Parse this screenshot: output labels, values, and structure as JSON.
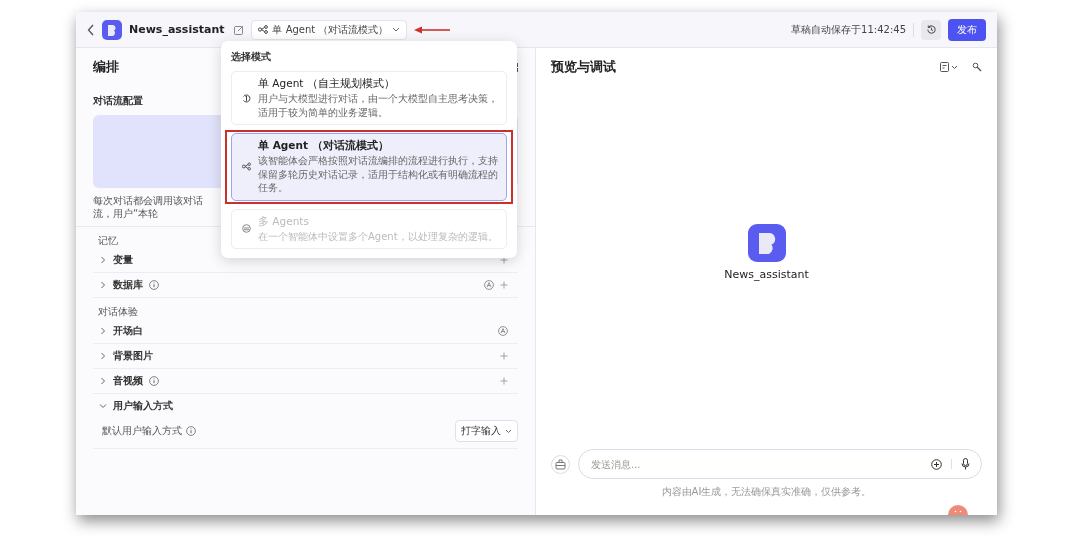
{
  "header": {
    "app_name": "News_assistant",
    "mode_button": "单 Agent （对话流模式）",
    "save_status": "草稿自动保存于11:42:45",
    "publish": "发布"
  },
  "mode_menu": {
    "title": "选择模式",
    "options": [
      {
        "title": "单 Agent （自主规划模式）",
        "description": "用户与大模型进行对话，由一个大模型自主思考决策，适用于较为简单的业务逻辑。",
        "selected": false,
        "disabled": false
      },
      {
        "title": "单 Agent （对话流模式）",
        "description": "该智能体会严格按照对话流编排的流程进行执行，支持保留多轮历史对话记录，适用于结构化或有明确流程的任务。",
        "selected": true,
        "disabled": false
      },
      {
        "title": "多 Agents",
        "description": "在一个智能体中设置多个Agent，以处理复杂的逻辑。",
        "selected": false,
        "disabled": true
      }
    ]
  },
  "left_panel": {
    "title": "编排",
    "flow_config": {
      "label": "对话流配置",
      "hint": "每次对话都会调用该对话流，用户“本轮"
    },
    "sections": [
      {
        "title": "记忆",
        "items": [
          {
            "label": "变量",
            "expanded": false,
            "info": false,
            "auto": false,
            "add": true
          },
          {
            "label": "数据库",
            "expanded": false,
            "info": true,
            "auto": true,
            "add": true
          }
        ]
      },
      {
        "title": "对话体验",
        "items": [
          {
            "label": "开场白",
            "expanded": false,
            "info": false,
            "auto": true,
            "add": false
          },
          {
            "label": "背景图片",
            "expanded": false,
            "info": false,
            "auto": false,
            "add": true
          },
          {
            "label": "音视频",
            "expanded": false,
            "info": true,
            "auto": false,
            "add": true
          },
          {
            "label": "用户输入方式",
            "expanded": true,
            "info": false,
            "auto": false,
            "add": false,
            "setting": {
              "label": "默认用户输入方式",
              "value": "打字输入"
            }
          }
        ]
      }
    ]
  },
  "right_panel": {
    "title": "预览与调试",
    "bot_name": "News_assistant",
    "input": {
      "placeholder": "发送消息..."
    },
    "disclaimer": "内容由AI生成，无法确保真实准确，仅供参考。"
  }
}
